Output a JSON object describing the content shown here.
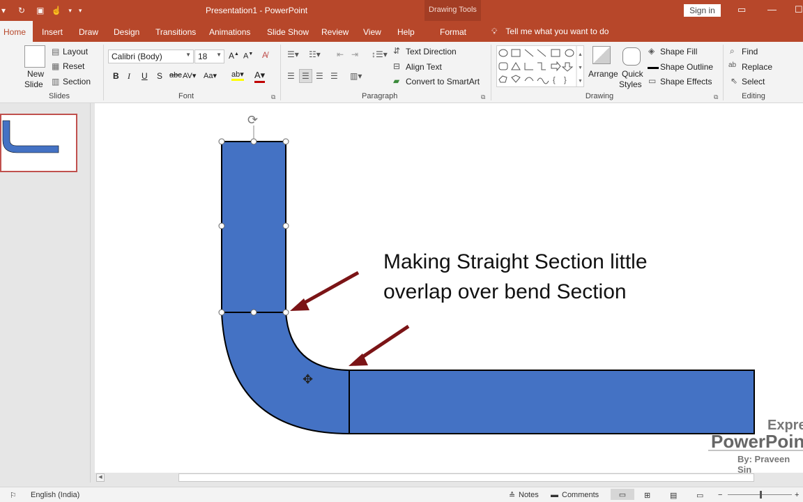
{
  "app": {
    "doc_title": "Presentation1  -  PowerPoint",
    "contextual_group": "Drawing Tools",
    "sign_in": "Sign in"
  },
  "tabs": [
    "Home",
    "Insert",
    "Draw",
    "Design",
    "Transitions",
    "Animations",
    "Slide Show",
    "Review",
    "View",
    "Help",
    "Format"
  ],
  "tell_me": "Tell me what you want to do",
  "ribbon": {
    "slides": {
      "new_slide_1": "New",
      "new_slide_2": "Slide",
      "layout": "Layout",
      "reset": "Reset",
      "section": "Section",
      "label": "Slides"
    },
    "font": {
      "name": "Calibri (Body)",
      "size": "18",
      "label": "Font"
    },
    "paragraph": {
      "text_direction": "Text Direction",
      "align_text": "Align Text",
      "convert_smartart": "Convert to SmartArt",
      "label": "Paragraph"
    },
    "drawing": {
      "arrange": "Arrange",
      "quick_styles_1": "Quick",
      "quick_styles_2": "Styles",
      "shape_fill": "Shape Fill",
      "shape_outline": "Shape Outline",
      "shape_effects": "Shape Effects",
      "label": "Drawing"
    },
    "editing": {
      "find": "Find",
      "replace": "Replace",
      "select": "Select",
      "label": "Editing"
    }
  },
  "slide": {
    "annotation_line1": "Making Straight Section little",
    "annotation_line2": "overlap over bend Section",
    "watermark_1": "Expre",
    "watermark_2": "PowerPoin",
    "watermark_3": "By: Praveen Sin",
    "shape_color": "#4472c4",
    "arrow_color": "#7b1416"
  },
  "status": {
    "language": "English (India)",
    "notes": "Notes",
    "comments": "Comments"
  },
  "colors": {
    "brand": "#b7472a",
    "ribbon_bg": "#f3f3f3"
  }
}
